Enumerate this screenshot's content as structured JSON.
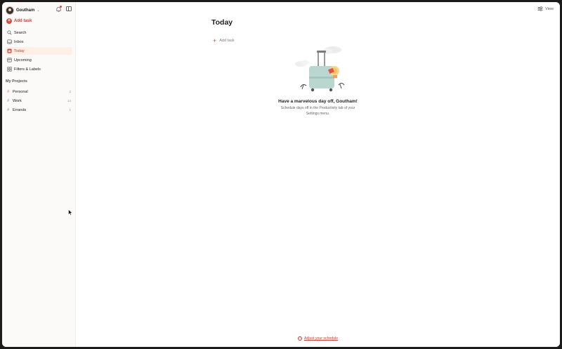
{
  "account": {
    "name": "Goutham"
  },
  "sidebar": {
    "add_task": "Add task",
    "items": [
      {
        "label": "Search",
        "icon": "search-icon"
      },
      {
        "label": "Inbox",
        "icon": "inbox-icon"
      },
      {
        "label": "Today",
        "icon": "calendar-today-icon",
        "active": true
      },
      {
        "label": "Upcoming",
        "icon": "calendar-upcoming-icon"
      },
      {
        "label": "Filters & Labels",
        "icon": "filters-icon"
      }
    ],
    "projects_heading": "My Projects",
    "projects": [
      {
        "label": "Personal",
        "count": "2"
      },
      {
        "label": "Work",
        "count": "14"
      },
      {
        "label": "Errands",
        "count": "1"
      }
    ]
  },
  "main": {
    "view_label": "View",
    "title": "Today",
    "add_task": "Add task",
    "empty_title": "Have a marvelous day off, Goutham!",
    "empty_subtitle": "Schedule days off in the Productivity tab of your Settings menu.",
    "adjust_link": "Adjust your schedule"
  },
  "colors": {
    "accent": "#dc4c3e",
    "active_bg": "#ffefe5",
    "sidebar_bg": "#fcfaf8"
  }
}
